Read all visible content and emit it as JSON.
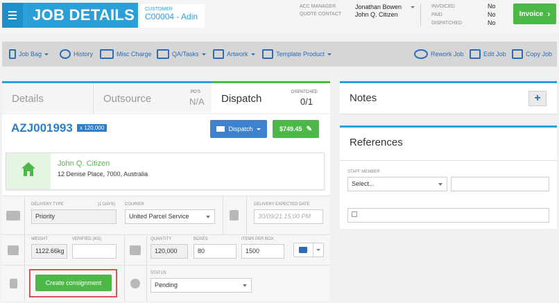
{
  "header": {
    "title": "JOB DETAILS",
    "customer_label": "CUSTOMER",
    "customer_value": "C00004 - Adin",
    "acc_manager_label": "ACC MANAGER",
    "acc_manager_value": "Jonathan Bowen",
    "quote_contact_label": "QUOTE CONTACT",
    "quote_contact_value": "John Q. Citizen",
    "invoiced_label": "INVOICED",
    "invoiced_value": "No",
    "paid_label": "PAID",
    "paid_value": "No",
    "dispatched_label": "DISPATCHED",
    "dispatched_value": "No",
    "invoice_button": "Invoice"
  },
  "toolbar": {
    "job_bag": "Job Bag",
    "history": "History",
    "misc_charge": "Misc Charge",
    "qa_tasks": "QA/Tasks",
    "artwork": "Artwork",
    "template_product": "Template Product",
    "rework_job": "Rework Job",
    "edit_job": "Edit Job",
    "copy_job": "Copy Job"
  },
  "tabs": {
    "details": "Details",
    "outsource": "Outsource",
    "pos_label": "PO'S",
    "pos_value": "N/A",
    "dispatch": "Dispatch",
    "dispatched_label": "DISPATCHED",
    "dispatched_value": "0/1"
  },
  "job": {
    "id": "AZJ001993",
    "qty_badge": "x 120,000",
    "dispatch_button": "Dispatch",
    "price_button": "$749.45"
  },
  "address": {
    "name": "John Q. Citizen",
    "line": "12 Denise Place, 7000, Australia"
  },
  "delivery": {
    "type_label": "DELIVERY TYPE",
    "days_label": "(1 DAYS)",
    "type_value": "Priority",
    "courier_label": "COURIER",
    "courier_value": "United Parcel Service",
    "expected_label": "DELIVERY EXPECTED DATE",
    "expected_value": "30/09/21 15:00 PM"
  },
  "weights": {
    "weight_label": "WEIGHT",
    "weight_value": "1122.66kg",
    "verified_label": "VERIFIED (KG)",
    "quantity_label": "QUANTITY",
    "quantity_value": "120,000",
    "boxes_label": "BOXES",
    "boxes_value": "80",
    "items_label": "ITEMS PER BOX",
    "items_value": "1500"
  },
  "consignment": {
    "button": "Create consignment",
    "status_label": "STATUS",
    "status_value": "Pending"
  },
  "notes": {
    "title": "Notes",
    "add": "+"
  },
  "references": {
    "title": "References",
    "staff_label": "STAFF MEMBER",
    "staff_select": "Select..."
  },
  "colors": {
    "brand_blue": "#2a9fd8",
    "green": "#4cb848",
    "highlight_red": "#d9534f"
  }
}
